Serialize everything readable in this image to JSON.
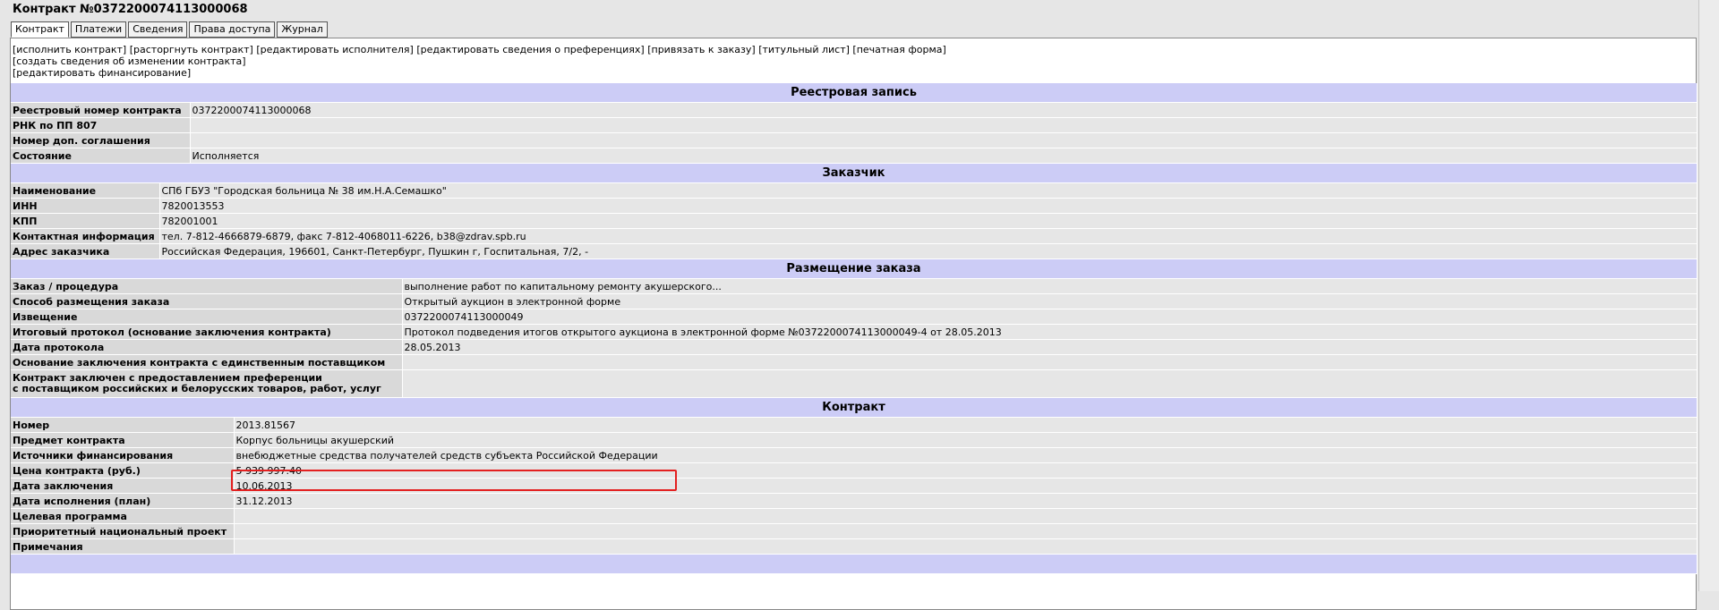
{
  "title": "Контракт №0372200074113000068",
  "tabs": [
    "Контракт",
    "Платежи",
    "Сведения",
    "Права доступа",
    "Журнал"
  ],
  "actions": {
    "line1": [
      "[исполнить контракт]",
      "[расторгнуть контракт]",
      "[редактировать исполнителя]",
      "[редактировать сведения о преференциях]",
      "[привязать к заказу]",
      "[титульный лист]",
      "[печатная форма]"
    ],
    "line2": "[создать сведения об изменении контракта]",
    "line3": "[редактировать финансирование]"
  },
  "registry": {
    "heading": "Реестровая запись",
    "rows": [
      {
        "label": "Реестровый номер контракта",
        "value": "0372200074113000068"
      },
      {
        "label": "РНК по ПП 807",
        "value": ""
      },
      {
        "label": "Номер доп. соглашения",
        "value": ""
      },
      {
        "label": "Состояние",
        "value": "Исполняется"
      }
    ]
  },
  "customer": {
    "heading": "Заказчик",
    "rows": [
      {
        "label": "Наименование",
        "value": "СПб ГБУЗ \"Городская больница № 38 им.Н.А.Семашко\""
      },
      {
        "label": "ИНН",
        "value": "7820013553"
      },
      {
        "label": "КПП",
        "value": "782001001"
      },
      {
        "label": "Контактная информация",
        "value": "тел. 7-812-4666879-6879, факс 7-812-4068011-6226, b38@zdrav.spb.ru"
      },
      {
        "label": "Адрес заказчика",
        "value": "Российская Федерация, 196601, Санкт-Петербург, Пушкин г, Госпитальная, 7/2, -"
      }
    ]
  },
  "placement": {
    "heading": "Размещение заказа",
    "rows": [
      {
        "label": "Заказ / процедура",
        "value": "выполнение работ по капитальному ремонту акушерского..."
      },
      {
        "label": "Способ размещения заказа",
        "value": "Открытый аукцион в электронной форме"
      },
      {
        "label": "Извещение",
        "value": "0372200074113000049"
      },
      {
        "label": "Итоговый протокол (основание заключения контракта)",
        "value": "Протокол подведения итогов открытого аукциона в электронной форме №0372200074113000049-4 от 28.05.2013"
      },
      {
        "label": "Дата протокола",
        "value": "28.05.2013"
      },
      {
        "label": "Основание заключения контракта с единственным поставщиком",
        "value": ""
      }
    ],
    "pref_label_1": "Контракт заключен с предоставлением преференции",
    "pref_label_2": "с поставщиком российских и белорусских товаров, работ, услуг",
    "pref_value": ""
  },
  "contract": {
    "heading": "Контракт",
    "rows": [
      {
        "label": "Номер",
        "value": "2013.81567"
      },
      {
        "label": "Предмет контракта",
        "value": "Корпус больницы акушерский"
      },
      {
        "label": "Источники финансирования",
        "value": "внебюджетные средства получателей средств субъекта Российской Федерации"
      },
      {
        "label": "Цена контракта (руб.)",
        "value": "5 939 997.40"
      },
      {
        "label": "Дата заключения",
        "value": "10.06.2013"
      },
      {
        "label": "Дата исполнения (план)",
        "value": "31.12.2013"
      },
      {
        "label": "Целевая программа",
        "value": ""
      },
      {
        "label": "Приоритетный национальный проект",
        "value": ""
      },
      {
        "label": "Примечания",
        "value": ""
      }
    ]
  }
}
